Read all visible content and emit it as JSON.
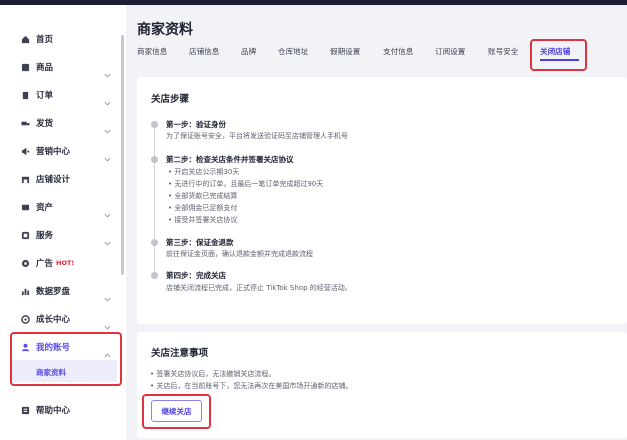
{
  "sidebar": {
    "items": [
      {
        "label": "首页",
        "icon": "home-icon",
        "chevron": false
      },
      {
        "label": "商品",
        "icon": "product-icon",
        "chevron": true
      },
      {
        "label": "订单",
        "icon": "order-icon",
        "chevron": true
      },
      {
        "label": "发货",
        "icon": "shipping-icon",
        "chevron": true
      },
      {
        "label": "营销中心",
        "icon": "marketing-icon",
        "chevron": true
      },
      {
        "label": "店铺设计",
        "icon": "store-design-icon",
        "chevron": false
      },
      {
        "label": "资产",
        "icon": "assets-icon",
        "chevron": true
      },
      {
        "label": "服务",
        "icon": "service-icon",
        "chevron": true
      },
      {
        "label": "广告",
        "icon": "ads-icon",
        "chevron": true,
        "badge": "HOT!"
      },
      {
        "label": "数据罗盘",
        "icon": "data-compass-icon",
        "chevron": true
      },
      {
        "label": "成长中心",
        "icon": "growth-icon",
        "chevron": true
      },
      {
        "label": "我的账号",
        "icon": "account-icon",
        "chevron": true,
        "expanded": true,
        "active": true
      },
      {
        "label": "帮助中心",
        "icon": "help-icon",
        "chevron": false
      }
    ],
    "sub_item": "商家资料"
  },
  "header": {
    "title": "商家资料",
    "tabs": [
      "商家信息",
      "店铺信息",
      "品牌",
      "仓库地址",
      "假期设置",
      "支付信息",
      "订阅设置",
      "账号安全",
      "关闭店铺"
    ],
    "active_tab": "关闭店铺"
  },
  "steps_card": {
    "title": "关店步骤",
    "step1_title": "第一步：验证身份",
    "step1_text": "为了保证账号安全，平台将发送验证码至店铺管理人手机号",
    "step2_title": "第二步：检查关店条件并签署关店协议",
    "step2_bullets": [
      "开启关店公示期30天",
      "无进行中的订单，且最后一笔订单完成超过90天",
      "全部货款已完成结算",
      "全部佣金已足额支付",
      "接受并签署关店协议"
    ],
    "step3_title": "第三步：保证金退款",
    "step3_text": "前往保证金页面，确认退款金额并完成退款流程",
    "step4_title": "第四步：完成关店",
    "step4_text": "店铺关闭流程已完成，正式停止 TikTok Shop 的经营活动。"
  },
  "notes_card": {
    "title": "关店注意事项",
    "notes": [
      "签署关店协议后，无法撤销关店流程。",
      "关店后，在当前账号下，您无法再次在美国市场开通新的店铺。"
    ],
    "button_label": "继续关店"
  },
  "colors": {
    "accent": "#4b3fe0",
    "highlight_border": "#e03342",
    "hot_badge": "#e0263a"
  }
}
